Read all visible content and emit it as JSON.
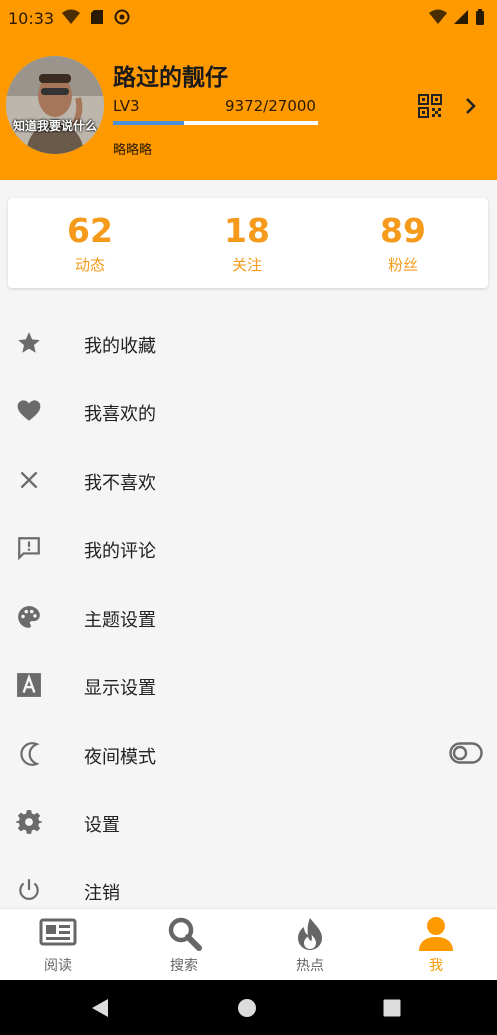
{
  "statusbar": {
    "time": "10:33"
  },
  "profile": {
    "username": "路过的靓仔",
    "level": "LV3",
    "exp_text": "9372/27000",
    "exp_progress": 0.347,
    "signature": "略略略",
    "avatar_caption": "知道我要说什么"
  },
  "stats": [
    {
      "value": "62",
      "label": "动态"
    },
    {
      "value": "18",
      "label": "关注"
    },
    {
      "value": "89",
      "label": "粉丝"
    }
  ],
  "menu": [
    {
      "label": "我的收藏",
      "icon": "star-icon"
    },
    {
      "label": "我喜欢的",
      "icon": "heart-icon"
    },
    {
      "label": "我不喜欢",
      "icon": "close-icon"
    },
    {
      "label": "我的评论",
      "icon": "comment-icon"
    },
    {
      "label": "主题设置",
      "icon": "palette-icon"
    },
    {
      "label": "显示设置",
      "icon": "font-icon"
    },
    {
      "label": "夜间模式",
      "icon": "moon-icon",
      "toggle": false
    },
    {
      "label": "设置",
      "icon": "gear-icon"
    },
    {
      "label": "注销",
      "icon": "power-icon"
    }
  ],
  "bottom_nav": [
    {
      "label": "阅读",
      "icon": "newspaper-icon",
      "active": false
    },
    {
      "label": "搜索",
      "icon": "search-icon",
      "active": false
    },
    {
      "label": "热点",
      "icon": "fire-icon",
      "active": false
    },
    {
      "label": "我",
      "icon": "person-icon",
      "active": true
    }
  ],
  "colors": {
    "accent": "#ff9900",
    "stat_text": "#f59a1b",
    "progress_fill": "#4a90d9"
  }
}
